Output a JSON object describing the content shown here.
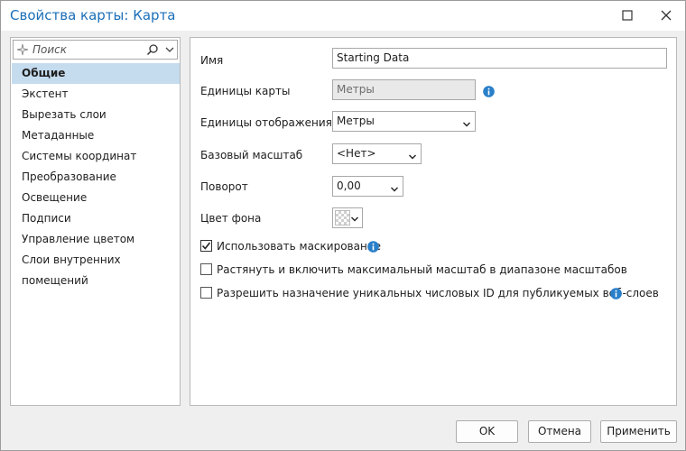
{
  "window": {
    "title": "Свойства карты: Карта"
  },
  "search": {
    "placeholder": "Поиск"
  },
  "nav": {
    "items": [
      {
        "label": "Общие"
      },
      {
        "label": "Экстент"
      },
      {
        "label": "Вырезать слои"
      },
      {
        "label": "Метаданные"
      },
      {
        "label": "Системы координат"
      },
      {
        "label": "Преобразование"
      },
      {
        "label": "Освещение"
      },
      {
        "label": "Подписи"
      },
      {
        "label": "Управление цветом"
      },
      {
        "label": "Слои внутренних помещений"
      }
    ],
    "active_index": 0
  },
  "general": {
    "name_label": "Имя",
    "name_value": "Starting Data",
    "map_units_label": "Единицы карты",
    "map_units_value": "Метры",
    "display_units_label": "Единицы отображения",
    "display_units_value": "Метры",
    "ref_scale_label": "Базовый масштаб",
    "ref_scale_value": "<Нет>",
    "rotation_label": "Поворот",
    "rotation_value": "0,00",
    "background_label": "Цвет фона",
    "options": [
      {
        "label": "Использовать маскирование",
        "checked": true,
        "info": true
      },
      {
        "label": "Растянуть и включить максимальный масштаб в диапазоне масштабов",
        "checked": false,
        "info": false
      },
      {
        "label": "Разрешить назначение уникальных числовых ID для публикуемых веб-слоев",
        "checked": false,
        "info": true
      }
    ]
  },
  "footer": {
    "ok": "OK",
    "cancel": "Отмена",
    "apply": "Применить"
  },
  "colors": {
    "accent": "#1b6fb8",
    "selection": "#c5dcef",
    "info_icon": "#2a7fc9"
  }
}
